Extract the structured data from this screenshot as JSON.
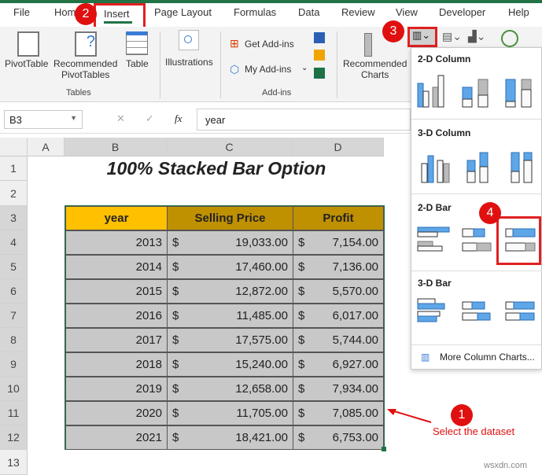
{
  "ribbon_tabs": [
    "File",
    "Home",
    "Insert",
    "Page Layout",
    "Formulas",
    "Data",
    "Review",
    "View",
    "Developer",
    "Help"
  ],
  "active_tab": "Insert",
  "ribbon": {
    "pivot_table": "PivotTable",
    "recommended_pivot": [
      "Recommended",
      "PivotTables"
    ],
    "table": "Table",
    "tables_group": "Tables",
    "illustrations": "Illustrations",
    "get_addins": "Get Add-ins",
    "my_addins": "My Add-ins",
    "addins_group": "Add-ins",
    "recommended_charts": [
      "Recommended",
      "Charts"
    ]
  },
  "formula_bar": {
    "name_box": "B3",
    "fx": "fx",
    "value": "year"
  },
  "columns": [
    "A",
    "B",
    "C",
    "D"
  ],
  "rows": [
    "1",
    "2",
    "3",
    "4",
    "5",
    "6",
    "7",
    "8",
    "9",
    "10",
    "11",
    "12",
    "13"
  ],
  "sheet": {
    "title": "100% Stacked Bar Option",
    "headers": [
      "year",
      "Selling Price",
      "Profit"
    ],
    "data": [
      [
        "2013",
        "$",
        "19,033.00",
        "$",
        "7,154.00"
      ],
      [
        "2014",
        "$",
        "17,460.00",
        "$",
        "7,136.00"
      ],
      [
        "2015",
        "$",
        "12,872.00",
        "$",
        "5,570.00"
      ],
      [
        "2016",
        "$",
        "11,485.00",
        "$",
        "6,017.00"
      ],
      [
        "2017",
        "$",
        "17,575.00",
        "$",
        "5,744.00"
      ],
      [
        "2018",
        "$",
        "15,240.00",
        "$",
        "6,927.00"
      ],
      [
        "2019",
        "$",
        "12,658.00",
        "$",
        "7,934.00"
      ],
      [
        "2020",
        "$",
        "11,705.00",
        "$",
        "7,085.00"
      ],
      [
        "2021",
        "$",
        "18,421.00",
        "$",
        "6,753.00"
      ]
    ]
  },
  "chart_menu": {
    "sections": [
      "2-D Column",
      "3-D Column",
      "2-D Bar",
      "3-D Bar"
    ],
    "more": "More Column Charts..."
  },
  "annotations": {
    "step1": "1",
    "step1_text": "Select the dataset",
    "step2": "2",
    "step3": "3",
    "step4": "4"
  },
  "watermark": "wsxdn.com",
  "colors": {
    "excel_green": "#217346",
    "header_fill": "#ffc000",
    "header_fill2": "#bf9000",
    "data_fill": "#c8c8c8",
    "annotation_red": "#e01010",
    "chart_blue": "#5ea6e8"
  }
}
